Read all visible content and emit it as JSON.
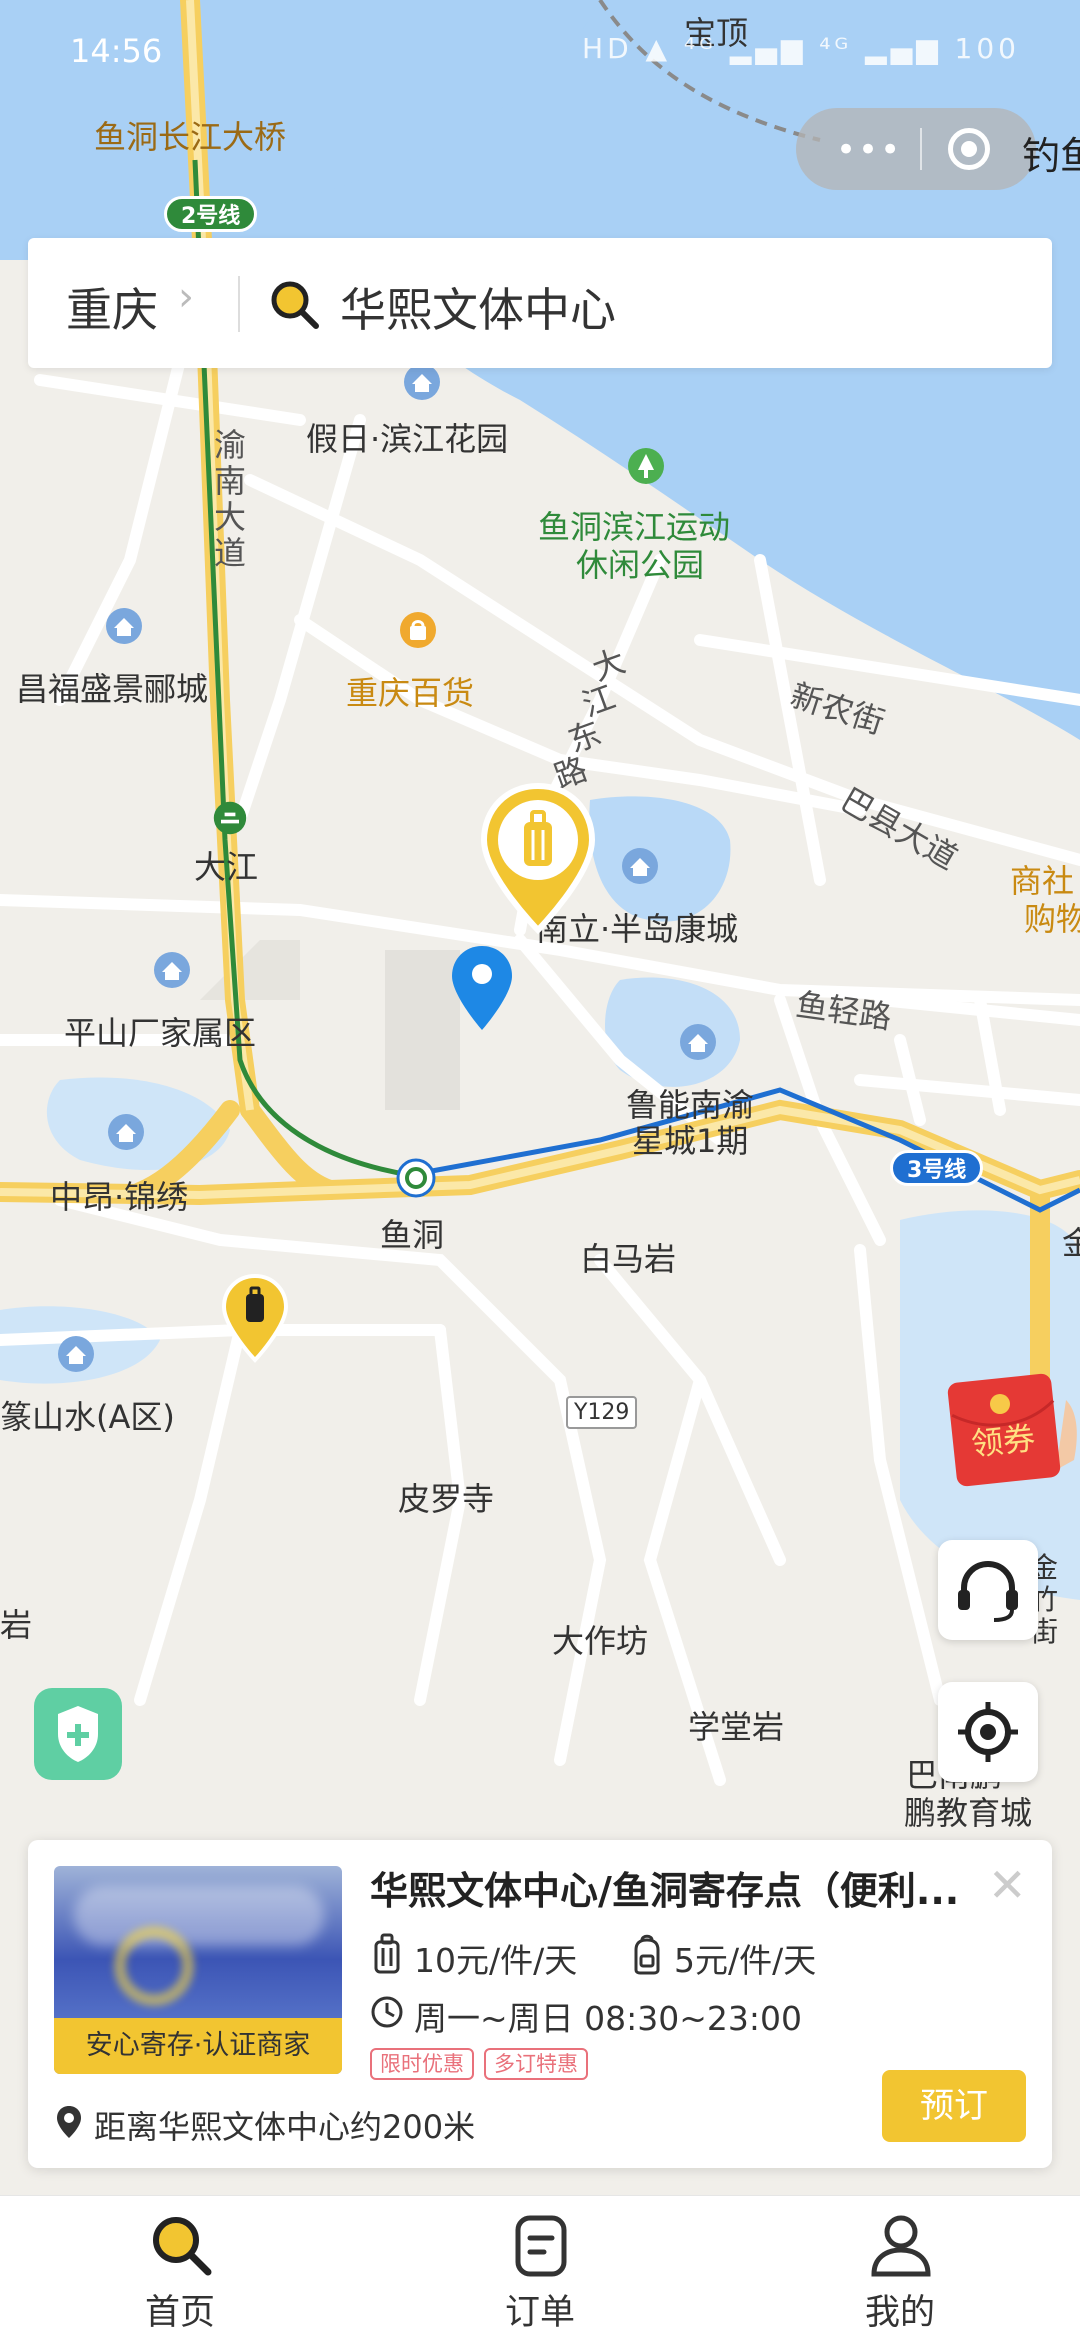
{
  "status_bar": {
    "time": "14:56",
    "icons": "HD ▲ ⁴ᴳ ▂▄▆ ⁴ᴳ ▂▄▆ 100"
  },
  "capsule": {
    "more_icon": "ellipsis-icon",
    "close_icon": "target-icon",
    "extra_text": "钓鱼"
  },
  "search": {
    "city": "重庆",
    "query": "华熙文体中心"
  },
  "map": {
    "labels": {
      "baoding": "宝顶",
      "bridge": "鱼洞长江大桥",
      "line2": "2号线",
      "yunan_road": [
        "渝",
        "南",
        "大",
        "道"
      ],
      "jiari": "假日·滨江花园",
      "park_line1": "鱼洞滨江运动",
      "park_line2": "休闲公园",
      "changfu": "昌福盛景郦城",
      "baihuo": "重庆百货",
      "dajiang_road": [
        "大",
        "江",
        "东",
        "路"
      ],
      "xinnong": "新农街",
      "baxian": "巴县大道",
      "shangshe": "商社",
      "gouwu": "购物",
      "dajiang": "大江",
      "bandao": "南立·半岛康城",
      "yuqing": "鱼轻路",
      "pingshan": "平山厂家属区",
      "luneng_line1": "鲁能南渝",
      "luneng_line2": "星城1期",
      "zhongang": "中昂·锦绣",
      "yudong": "鱼洞",
      "line3": "3号线",
      "jin": "金",
      "baimayan": "白马岩",
      "zhuanshan": "篆山水(A区)",
      "y129": "Y129",
      "piluosi": "皮罗寺",
      "yan": "岩",
      "dazuofang": "大作坊",
      "xuetangyan": "学堂岩",
      "jinzhu": [
        "金",
        "竹",
        "街"
      ],
      "bapeng_line1": "巴南鹏",
      "bapeng_line2": "鹏教育城"
    },
    "coupon_label": "领券"
  },
  "card": {
    "title": "华熙文体中心/鱼洞寄存点（便利...",
    "badge": "安心寄存·认证商家",
    "price_luggage": "10元/件/天",
    "price_bag": "5元/件/天",
    "hours": "周一~周日 08:30~23:00",
    "tags": [
      "限时优惠",
      "多订特惠"
    ],
    "distance": "距离华熙文体中心约200米",
    "book_label": "预订"
  },
  "tabs": [
    {
      "label": "首页",
      "icon": "search-icon"
    },
    {
      "label": "订单",
      "icon": "order-icon"
    },
    {
      "label": "我的",
      "icon": "user-icon"
    }
  ],
  "colors": {
    "accent": "#f2c531",
    "water": "#a9d0f5",
    "tag": "#e9717b",
    "pin": "#1e88e5",
    "metro_line3": "#1f6fd1",
    "metro_line2": "#2f8a3a"
  }
}
